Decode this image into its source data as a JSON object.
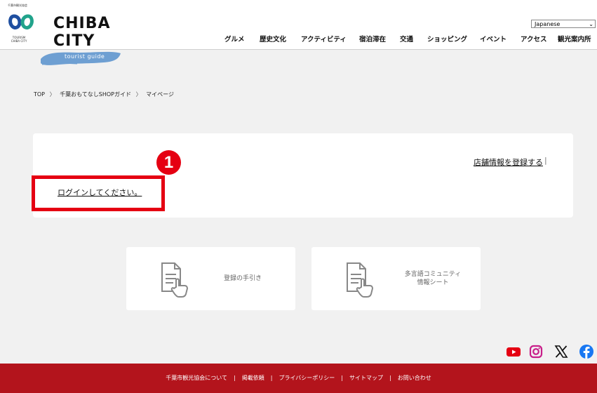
{
  "header": {
    "association_label": "千葉市観光協会",
    "tourism_label_line1": "TOURISM",
    "tourism_label_line2": "CHIBA CITY",
    "brand_line1": "CHIBA",
    "brand_line2": "CITY",
    "brand_tagline": "tourist guide",
    "language_select": "Japanese",
    "nav": [
      "グルメ",
      "歴史文化",
      "アクティビティ",
      "宿泊滞在",
      "交通",
      "ショッピング",
      "イベント",
      "アクセス",
      "観光案内所"
    ]
  },
  "breadcrumb": [
    "TOP",
    "千葉おもてなしSHOPガイド",
    "マイページ"
  ],
  "breadcrumb_sep": "〉",
  "main": {
    "register_link": "店舗情報を登録する",
    "register_sep": "|",
    "login_link": "ログインしてください。",
    "step_badge": "1"
  },
  "guides": [
    {
      "line1": "登録の手引き",
      "line2": ""
    },
    {
      "line1": "多言語コミュニティ",
      "line2": "情報シート"
    }
  ],
  "social": [
    "youtube-icon",
    "instagram-icon",
    "x-icon",
    "facebook-icon"
  ],
  "footer": {
    "links": [
      "千葉市観光協会について",
      "掲載依頼",
      "プライバシーポリシー",
      "サイトマップ",
      "お問い合わせ"
    ],
    "sep": "|"
  },
  "colors": {
    "accent_red": "#e50012",
    "footer_red": "#b3141c",
    "brush_blue": "#6e9fd2",
    "logo_blue": "#1f4fa0",
    "logo_green": "#21a38b"
  }
}
